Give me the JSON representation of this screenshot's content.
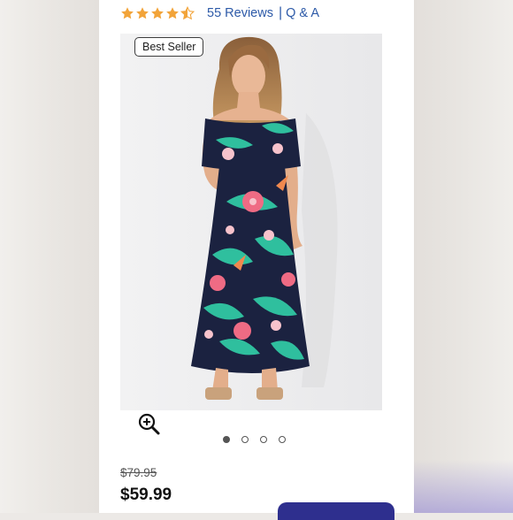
{
  "rating": {
    "stars": 4.5,
    "reviews_label": "55 Reviews",
    "separator": "|",
    "qa_label": "Q & A"
  },
  "product_image": {
    "badge": "Best Seller",
    "icon": "zoom-in-icon",
    "carousel": {
      "count": 4,
      "active_index": 0
    }
  },
  "pricing": {
    "original_price": "$79.95",
    "sale_price": "$59.99"
  },
  "colors": {
    "link": "#2d5aa8",
    "star": "#f2a43a",
    "dress_navy": "#1b2240",
    "leaf_teal": "#2fbf9e",
    "flower_pink": "#ef6b84"
  }
}
